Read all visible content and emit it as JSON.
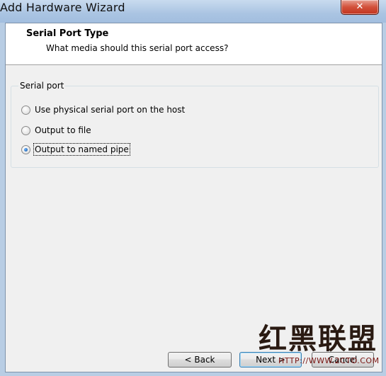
{
  "window": {
    "title": "Add Hardware Wizard",
    "close_glyph": "✕"
  },
  "header": {
    "title": "Serial Port Type",
    "subtitle": "What media should this serial port access?"
  },
  "group": {
    "label": "Serial port",
    "options": [
      {
        "label": "Use physical serial port on the host",
        "checked": false
      },
      {
        "label": "Output to file",
        "checked": false
      },
      {
        "label": "Output to named pipe",
        "checked": true
      }
    ]
  },
  "buttons": {
    "back": "< Back",
    "next": "Next >",
    "cancel": "Cancel"
  },
  "watermark": {
    "chars": "红黑联盟",
    "url": "HTTP://WWW.2CTO.COM"
  }
}
